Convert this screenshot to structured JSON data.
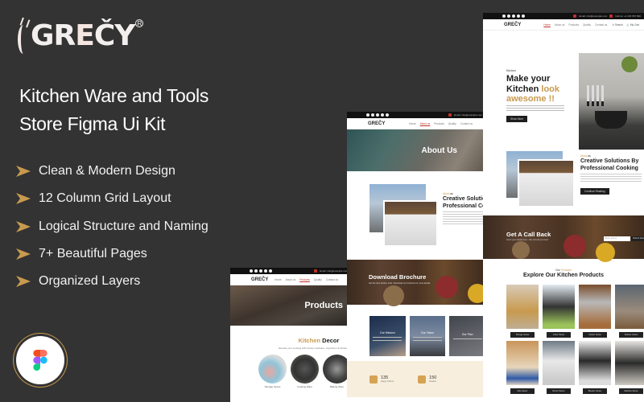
{
  "brand": {
    "logo_text_pre": "GR",
    "logo_text_e": "E",
    "logo_text_post": "ČY",
    "registered_mark": "R"
  },
  "headline": {
    "line1": "Kitchen Ware and Tools",
    "line2": "Store Figma Ui Kit"
  },
  "features": [
    {
      "label": "Clean & Modern Design",
      "icon": "arrow-right-icon"
    },
    {
      "label": "12 Column Grid Layout",
      "icon": "arrow-right-icon"
    },
    {
      "label": "Logical Structure and Naming",
      "icon": "arrow-right-icon"
    },
    {
      "label": "7+ Beautiful Pages",
      "icon": "arrow-right-icon"
    },
    {
      "label": "Organized Layers",
      "icon": "arrow-right-icon"
    }
  ],
  "figma_badge": {
    "icon": "figma-icon"
  },
  "colors": {
    "background": "#333333",
    "accent": "#c89a4e",
    "brand_red": "#c0302b",
    "text": "#ffffff"
  },
  "mockups": {
    "nav": {
      "logo": "GREČY",
      "links": [
        "Home",
        "About us",
        "Products",
        "Quality",
        "Contact us"
      ],
      "search": "Search",
      "cart": "My Cart",
      "email": "Email: info@example.com",
      "phone": "Call us: +1 234 567 890"
    },
    "products_page": {
      "hero_title": "Products",
      "active_link": "Products",
      "section_title_accent": "Kitchen",
      "section_title_rest": " Decor",
      "section_subtitle": "Elevate your cooking with trendy cookware, organizers & kitchen",
      "categories": [
        "Storage Series",
        "Cooking Ware",
        "Baking Ware"
      ]
    },
    "about_page": {
      "hero_title": "About Us",
      "active_link": "About us",
      "tag_accent": "About",
      "tag_rest": " us",
      "heading_line1": "Creative Solutions By",
      "heading_line2": "Professional Cooking",
      "brochure_title": "Download Brochure",
      "brochure_sub": "Get the best kitchen tools. Download our brochure for more details",
      "cards": [
        "Our Mission",
        "Our Vision",
        "Our Plan"
      ],
      "stats": [
        {
          "value": "135",
          "label": "Happy Clients"
        },
        {
          "value": "150",
          "label": "Dealers"
        }
      ]
    },
    "home_page": {
      "active_link": "Home",
      "kicker": "Kitchen",
      "h1_line1": "Make your",
      "h1_line2_dark": "Kitchen ",
      "h1_line2_accent": "look",
      "h1_line3_accent": "awesome !!",
      "hero_button": "Show More",
      "about_tag_accent": "About",
      "about_tag_rest": " us",
      "about_heading_line1": "Creative Solutions By",
      "about_heading_line2": "Professional Cooking",
      "about_button": "Continue Reading",
      "callback_title": "Get A Call Back",
      "callback_sub": "Send your details here - We will call you back",
      "callback_input_placeholder": "Enter phone",
      "callback_submit": "Submit Now",
      "products_kicker_dark": "Our ",
      "products_kicker_accent": "Products",
      "products_heading": "Explore Our Kitchen Products",
      "products": [
        "Storage Series",
        "Juicer Series",
        "Cooker Series",
        "Strainer Series",
        "Mop Series",
        "Dinner Series",
        "Blender Series",
        "Machine Series"
      ]
    }
  }
}
